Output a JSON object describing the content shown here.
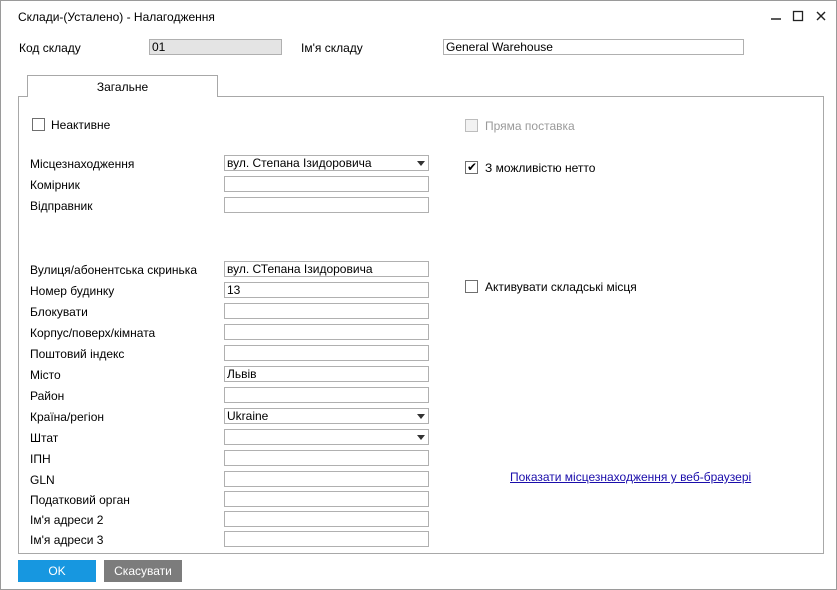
{
  "window": {
    "title": "Склади-(Усталено) - Налагодження",
    "controls": [
      "minimize-icon",
      "maximize-icon",
      "close-icon"
    ]
  },
  "header": {
    "code_label": "Код складу",
    "code_value": "01",
    "name_label": "Ім'я складу",
    "name_value": "General Warehouse"
  },
  "tabs": [
    {
      "label": "Загальне",
      "active": true
    }
  ],
  "left": {
    "inactive_label": "Неактивне",
    "inactive_checked": false,
    "location_label": "Місцезнаходження",
    "location_value": "вул. Степана Ізидоровича",
    "storekeeper_label": "Комірник",
    "storekeeper_value": "",
    "sender_label": "Відправник",
    "sender_value": "",
    "address": [
      {
        "label": "Вулиця/абонентська скринька",
        "value": "вул. СТепана Ізидоровича",
        "dropdown": false
      },
      {
        "label": "Номер будинку",
        "value": "13",
        "dropdown": false
      },
      {
        "label": "Блокувати",
        "value": "",
        "dropdown": false
      },
      {
        "label": "Корпус/поверх/кімната",
        "value": "",
        "dropdown": false
      },
      {
        "label": "Поштовий індекс",
        "value": "",
        "dropdown": false
      },
      {
        "label": "Місто",
        "value": "Львів",
        "dropdown": false
      },
      {
        "label": "Район",
        "value": "",
        "dropdown": false
      },
      {
        "label": "Країна/регіон",
        "value": "Ukraine",
        "dropdown": true
      },
      {
        "label": "Штат",
        "value": "",
        "dropdown": true
      },
      {
        "label": "ІПН",
        "value": "",
        "dropdown": false
      },
      {
        "label": "GLN",
        "value": "",
        "dropdown": false
      },
      {
        "label": "Податковий орган",
        "value": "",
        "dropdown": false
      },
      {
        "label": "Ім'я адреси 2",
        "value": "",
        "dropdown": false
      },
      {
        "label": "Ім'я адреси 3",
        "value": "",
        "dropdown": false
      }
    ]
  },
  "right": {
    "direct_delivery_label": "Пряма поставка",
    "direct_delivery_checked": false,
    "direct_delivery_disabled": true,
    "netto_label": "З можливістю нетто",
    "netto_checked": true,
    "bin_locations_label": "Активувати складські місця",
    "bin_locations_checked": false,
    "show_location_link": "Показати місцезнаходження у веб-браузері"
  },
  "footer": {
    "ok_label": "OK",
    "cancel_label": "Скасувати"
  },
  "colors": {
    "ok_button": "#1797e0",
    "cancel_button": "#7c7c7c",
    "link": "#1a0dab"
  }
}
